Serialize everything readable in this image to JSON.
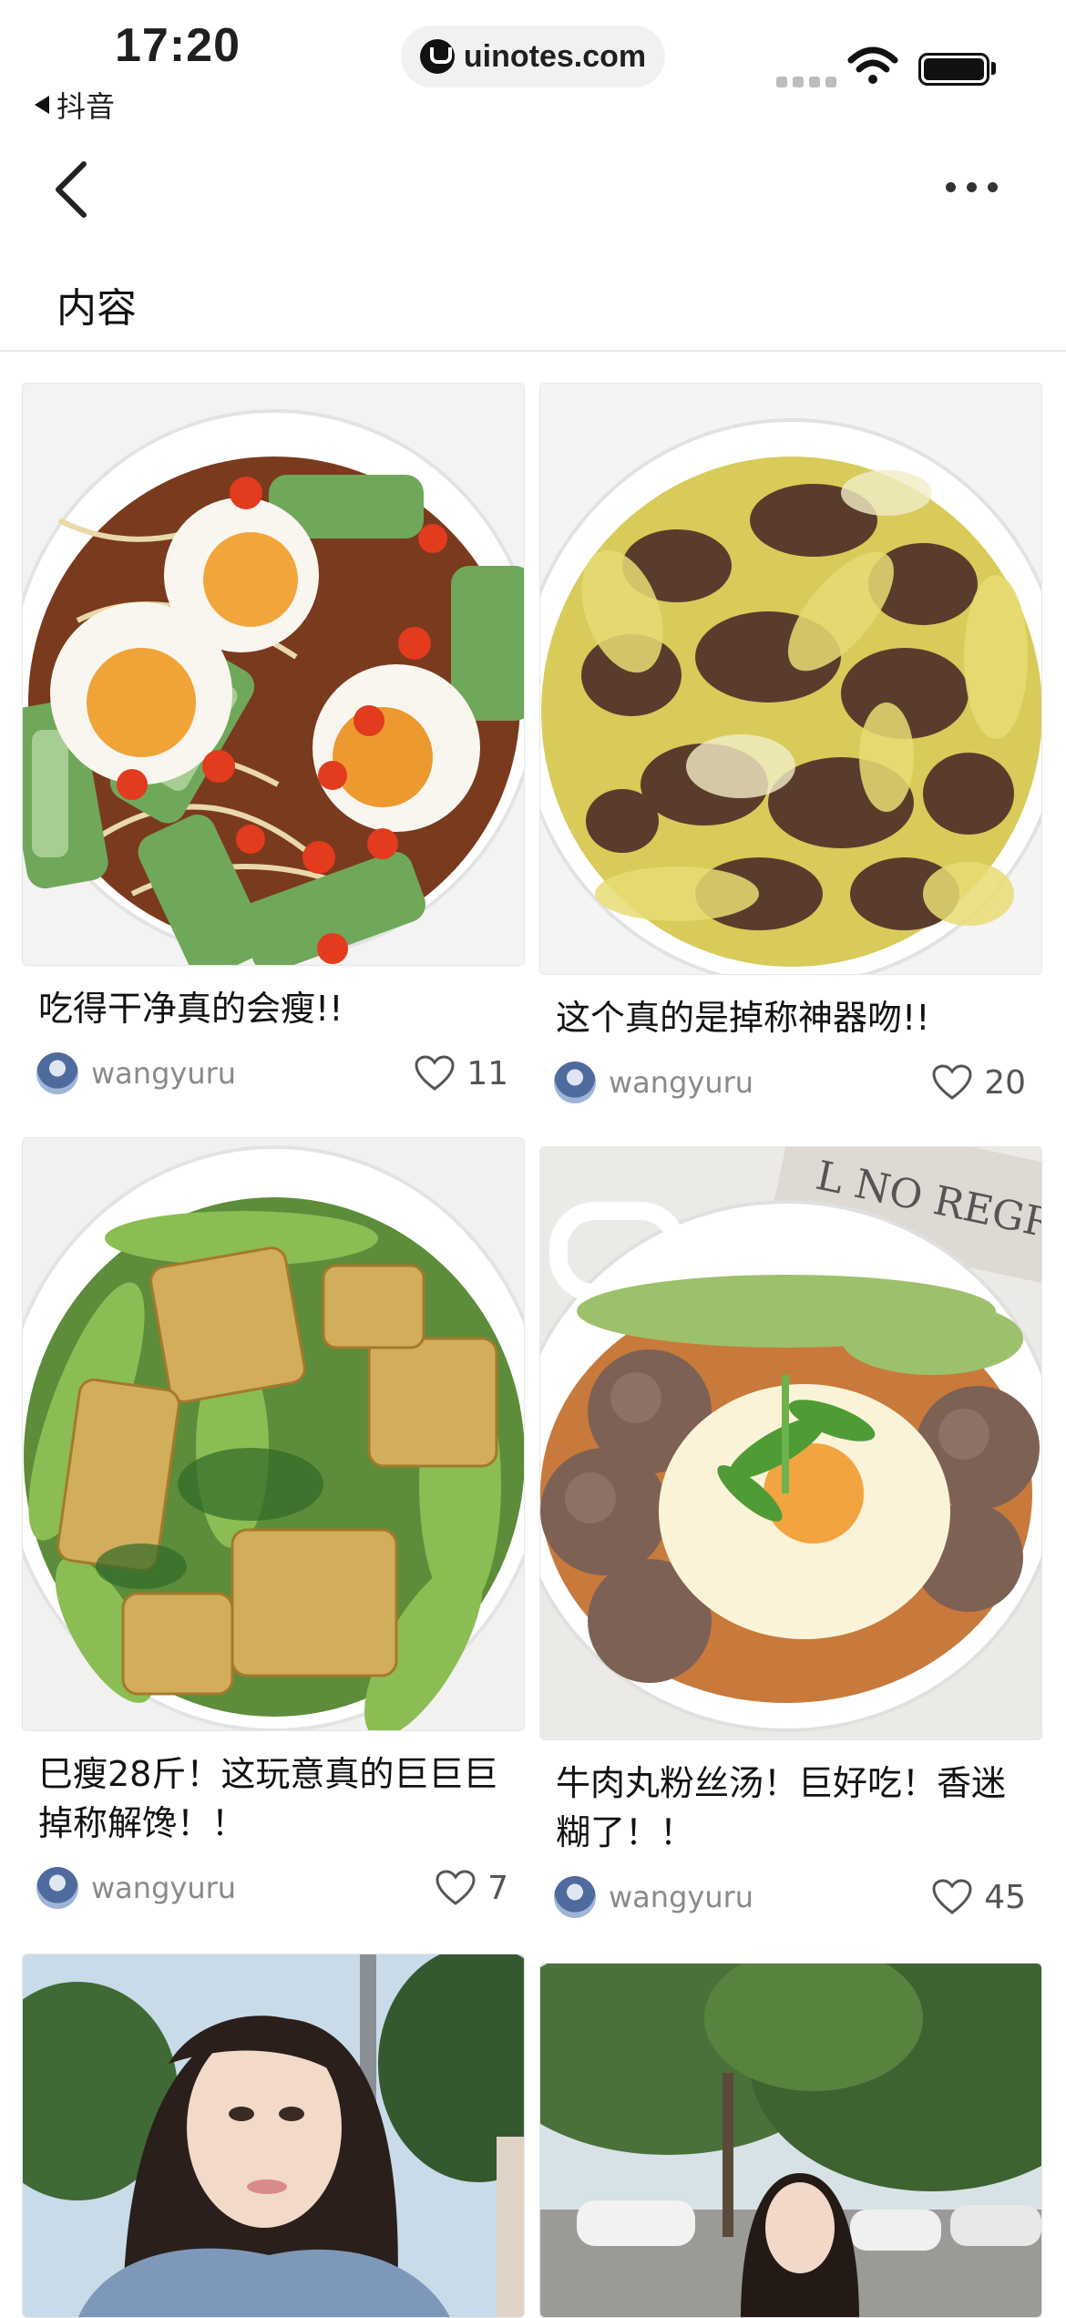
{
  "status_bar": {
    "time": "17:20",
    "back_app": "抖音",
    "url": "uinotes.com"
  },
  "nav": {
    "section_title": "内容"
  },
  "icons": {
    "back": "chevron-left-icon",
    "more": "more-horizontal-icon",
    "like": "heart-outline-icon",
    "wifi": "wifi-icon",
    "battery": "battery-icon"
  },
  "posts": [
    {
      "title": "吃得干净真的会瘦!!",
      "author": "wangyuru",
      "likes": "11",
      "image": "noodle bowl with eggs, cucumber and chili"
    },
    {
      "title": "这个真的是掉称神器吻!!",
      "author": "wangyuru",
      "likes": "20",
      "image": "beef with napa cabbage bowl"
    },
    {
      "title": "巳瘦28斤！这玩意真的巨巨巨掉称解馋！！",
      "author": "wangyuru",
      "likes": "7",
      "image": "tofu and lettuce noodle bowl"
    },
    {
      "title": "牛肉丸粉丝汤！巨好吃！香迷糊了！！",
      "author": "wangyuru",
      "likes": "45",
      "image": "beef ball vermicelli soup with fried egg"
    },
    {
      "title": "",
      "author": "",
      "likes": "",
      "image": "portrait photo of a woman outdoors"
    },
    {
      "title": "",
      "author": "",
      "likes": "",
      "image": "street with trees and a woman"
    }
  ],
  "colors": {
    "background": "#ffffff",
    "text": "#111111",
    "secondary": "#8a8a8a",
    "divider": "#ececec"
  }
}
